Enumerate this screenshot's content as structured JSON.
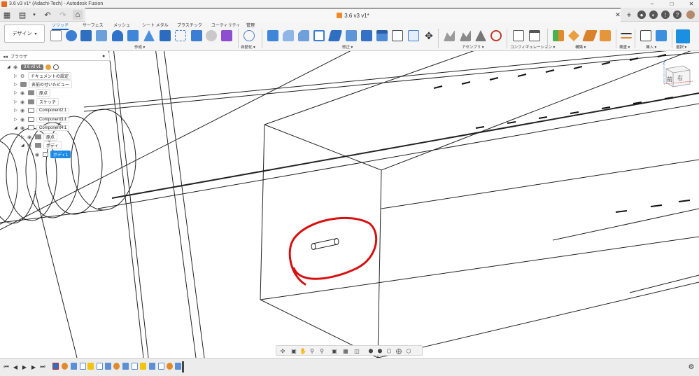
{
  "window": {
    "title": "3.6 v3 v1* (Adachi-Tech) - Autodesk Fusion"
  },
  "tab": {
    "title": "3.6 v3 v1*"
  },
  "ribbon": {
    "workspace": "デザイン",
    "tabs": [
      "ソリッド",
      "サーフェス",
      "メッシュ",
      "シート メタル",
      "プラスチック",
      "ユーティリティ",
      "管理"
    ],
    "groups": [
      "作成",
      "自動化",
      "修正",
      "アセンブリ",
      "コンフィギュレーション",
      "構築",
      "検査",
      "挿入",
      "選択"
    ]
  },
  "browser": {
    "title": "ブラウザ",
    "root": "3.6 v3 v1",
    "nodes": [
      "ドキュメントの設定",
      "名前の付いたビュー",
      "原点",
      "スケッチ",
      "Component2:1",
      "Component3:1",
      "Component4:1",
      "原点",
      "ボディ",
      "ボディ1"
    ]
  },
  "viewcube": {
    "front": "前",
    "right": "右",
    "axis": "Z"
  },
  "colors": {
    "accent": "#0a62c9",
    "selection": "#1a8ae6",
    "annotation": "#d81010",
    "brand": "#f08a24"
  },
  "icons": {
    "nav": [
      "orbit-icon",
      "look-at-icon",
      "pan-icon",
      "zoom-window-icon",
      "zoom-icon",
      "display-mode-icon",
      "grid-icon",
      "viewports-icon",
      "visual-style-icons"
    ],
    "timeline": [
      "go-to-start-icon",
      "step-back-icon",
      "play-icon",
      "step-forward-icon",
      "go-to-end-icon"
    ]
  }
}
